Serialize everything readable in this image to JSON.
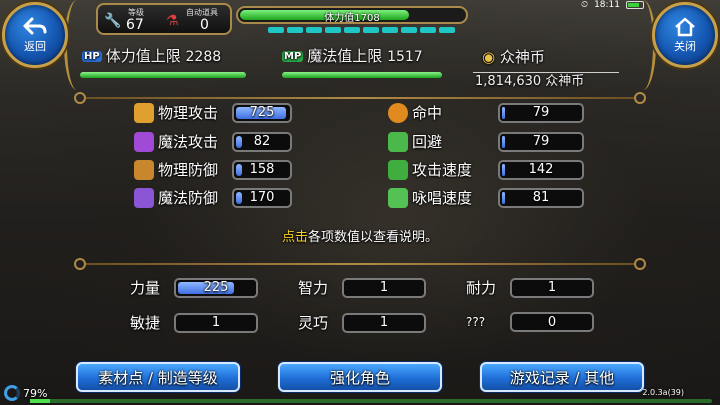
{
  "top": {
    "back_label": "返回",
    "close_label": "关闭",
    "level_label": "等级",
    "level_value": "67",
    "auto_item_label": "自动道具",
    "auto_item_value": "0",
    "hp_bar_text": "体力值1708",
    "clock": "18:11"
  },
  "summary": {
    "hp_tag": "HP",
    "hp_label": "体力值上限",
    "hp_value": "2288",
    "mp_tag": "MP",
    "mp_label": "魔法值上限",
    "mp_value": "1517",
    "coin_label": "众神币",
    "coin_value": "1,814,630 众神币"
  },
  "stats": [
    {
      "label": "物理攻击",
      "value": "725",
      "icon": "sword-icon",
      "color": "#e0a030"
    },
    {
      "label": "魔法攻击",
      "value": "82",
      "icon": "magic-staff-icon",
      "color": "#a24ad8"
    },
    {
      "label": "物理防御",
      "value": "158",
      "icon": "shield-icon",
      "color": "#c8872c"
    },
    {
      "label": "魔法防御",
      "value": "170",
      "icon": "magic-shield-icon",
      "color": "#8a56d6"
    },
    {
      "label": "命中",
      "value": "79",
      "icon": "target-icon",
      "color": "#e08a20"
    },
    {
      "label": "回避",
      "value": "79",
      "icon": "boot-icon",
      "color": "#4ab84a"
    },
    {
      "label": "攻击速度",
      "value": "142",
      "icon": "attack-speed-icon",
      "color": "#3fae3f"
    },
    {
      "label": "咏唱速度",
      "value": "81",
      "icon": "cast-speed-icon",
      "color": "#53c153"
    }
  ],
  "hint": {
    "highlight": "点击",
    "rest": "各项数值以查看说明。"
  },
  "attributes": [
    {
      "label": "力量",
      "value": "225"
    },
    {
      "label": "智力",
      "value": "1"
    },
    {
      "label": "耐力",
      "value": "1"
    },
    {
      "label": "敏捷",
      "value": "1"
    },
    {
      "label": "灵巧",
      "value": "1"
    },
    {
      "label": "???",
      "value": "0"
    }
  ],
  "buttons": {
    "materials": "素材点 / 制造等级",
    "enhance": "强化角色",
    "records": "游戏记录 / 其他"
  },
  "footer": {
    "percent": "79%",
    "version": "2.0.3a(39)"
  }
}
